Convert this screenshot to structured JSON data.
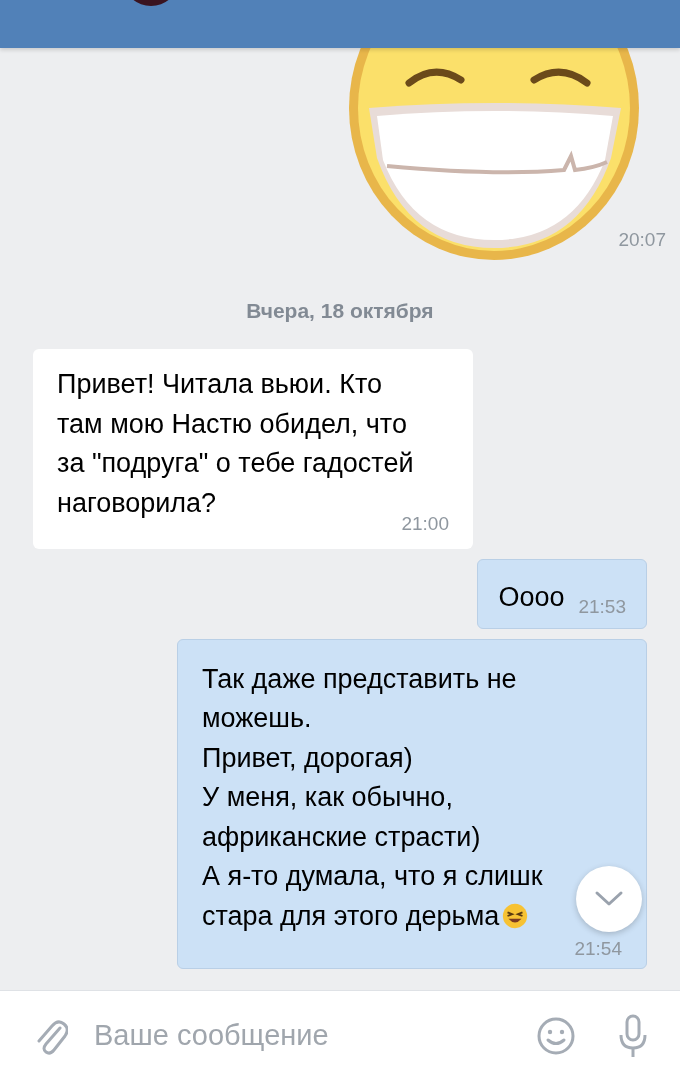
{
  "sticker": {
    "kind": "picture",
    "time": "20:07"
  },
  "date_divider": "Вчера, 18 октября",
  "messages": [
    {
      "kind": "incoming",
      "lines": [
        "Привет! Читала вьюи. Кто",
        "там мою Настю обидел, что",
        "за \"подруга\" о тебе гадостей",
        "наговорила?"
      ],
      "time": "21:00"
    },
    {
      "kind": "outgoing",
      "lines": [
        "Оооо"
      ],
      "time": "21:53"
    },
    {
      "kind": "outgoing",
      "lines": [
        "Так даже представить не",
        "можешь.",
        "Привет, дорогая)",
        "У меня, как обычно,",
        "африканские страсти)",
        "А я-то думала,  что я слишк",
        "стара для этого дерьма"
      ],
      "time": "21:54"
    }
  ],
  "composer": {
    "placeholder": "Ваше сообщение"
  }
}
